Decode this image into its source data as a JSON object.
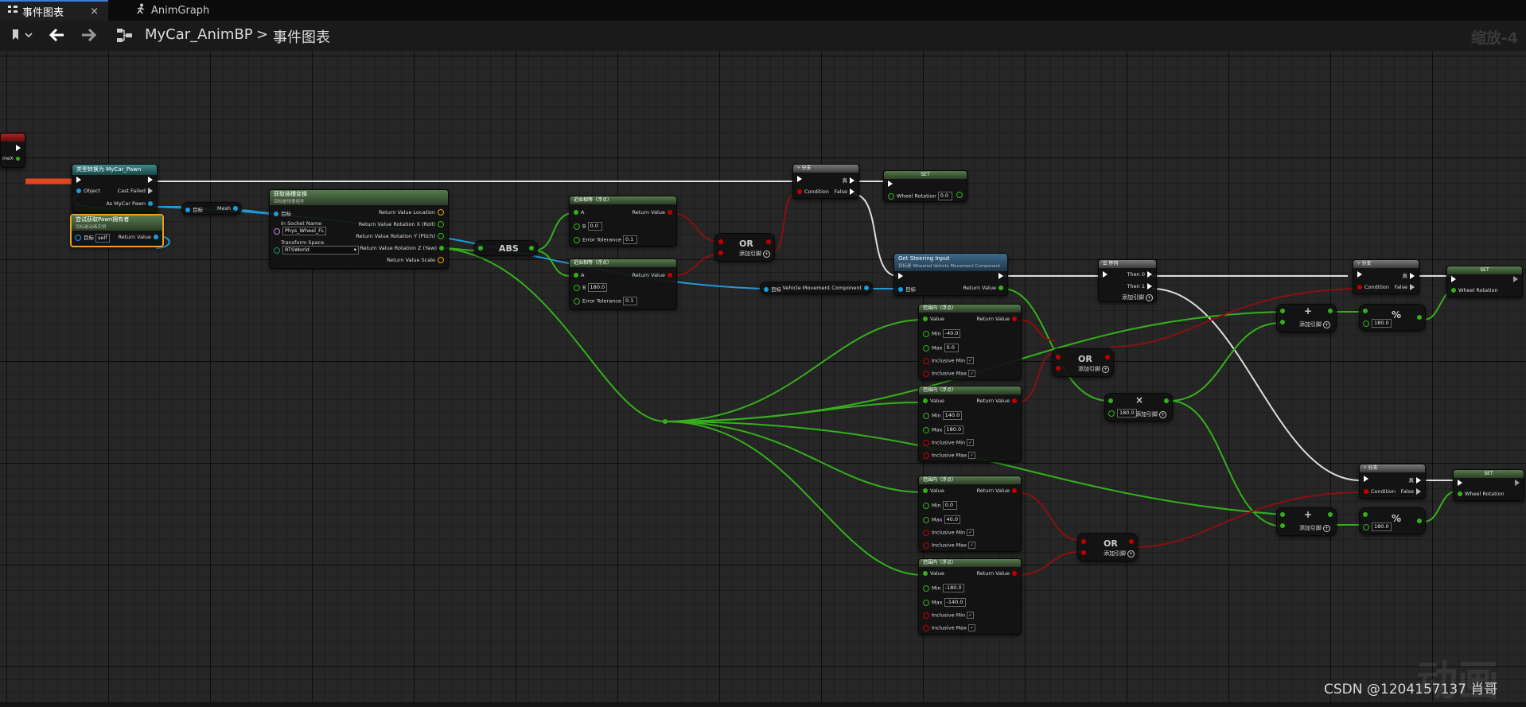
{
  "tabs": [
    {
      "label": "事件图表",
      "close": "×",
      "icon": "event-graph-icon"
    },
    {
      "label": "AnimGraph",
      "icon": "anim-graph-icon"
    }
  ],
  "toolbar": {
    "breadcrumb_root": "MyCar_AnimBP",
    "breadcrumb_sep": ">",
    "breadcrumb_current": "事件图表",
    "zoom": "缩放-4"
  },
  "watermark": {
    "big": "动画",
    "caption": "CSDN @1204157137 肖哥"
  },
  "colors": {
    "exec": "#ffffff",
    "bool": "#c00000",
    "float": "#34b01a",
    "object": "#1f9ad8",
    "struct": "#f0a000",
    "name": "#c27ee3",
    "accent": "#3a7bd5"
  },
  "nodes": {
    "left_edge": {
      "pin_label": "meX"
    },
    "cast": {
      "title": "类型转换为 MyCar_Pawn",
      "exec_in": "",
      "object": "Object",
      "cast_failed": "Cast Failed",
      "as_pawn": "As MyCar Pawn"
    },
    "try_get": {
      "title": "尝试获取Pawn拥有者",
      "subtitle": "目标是动画实例",
      "target": "目标",
      "target_value": "self",
      "return": "Return Value"
    },
    "mesh": {
      "target": "目标",
      "mesh": "Mesh"
    },
    "socket": {
      "title": "获取插槽变换",
      "subtitle": "目标是场景组件",
      "target": "目标",
      "in_socket": "In Socket Name",
      "socket_value": "Phys_Wheel_FL",
      "transform_space": "Transform Space",
      "space_value": "RTSWorld",
      "out": [
        "Return Value Location",
        "Return Value Rotation X (Roll)",
        "Return Value Rotation Y (Pitch)",
        "Return Value Rotation Z (Yaw)",
        "Return Value Scale"
      ]
    },
    "abs": {
      "label": "ABS"
    },
    "near1": {
      "title": "近似相等（浮点）",
      "a": "A",
      "b": "B",
      "b_value": "0.0",
      "tol": "Error Tolerance",
      "tol_value": "0.1",
      "ret": "Return Value"
    },
    "near2": {
      "title": "近似相等（浮点）",
      "a": "A",
      "b": "B",
      "b_value": "180.0",
      "tol": "Error Tolerance",
      "tol_value": "0.1",
      "ret": "Return Value"
    },
    "or1": {
      "label": "OR",
      "add": "添加引脚"
    },
    "branch1": {
      "title": "分支",
      "true": "真",
      "false": "False",
      "condition": "Condition"
    },
    "set1": {
      "title": "SET",
      "pin": "Wheel Rotation",
      "value": "0.0"
    },
    "vehicle": {
      "target": "目标",
      "out": "Vehicle Movement Component"
    },
    "steering": {
      "title": "Get Steering Input",
      "subtitle": "目标是 Wheeled Vehicle Movement Component",
      "target": "目标",
      "ret": "Return Value"
    },
    "sequence": {
      "title": "序列",
      "then0": "Then 0",
      "then1": "Then 1",
      "add": "添加引脚"
    },
    "inrange1": {
      "title": "范围内（浮点）",
      "value": "Value",
      "min": "Min",
      "min_value": "-40.0",
      "max": "Max",
      "max_value": "0.0",
      "incmin": "Inclusive Min",
      "incmax": "Inclusive Max",
      "ret": "Return Value"
    },
    "inrange2": {
      "title": "范围内（浮点）",
      "value": "Value",
      "min": "Min",
      "min_value": "140.0",
      "max": "Max",
      "max_value": "180.0",
      "incmin": "Inclusive Min",
      "incmax": "Inclusive Max",
      "ret": "Return Value"
    },
    "inrange3": {
      "title": "范围内（浮点）",
      "value": "Value",
      "min": "Min",
      "min_value": "0.0",
      "max": "Max",
      "max_value": "40.0",
      "incmin": "Inclusive Min",
      "incmax": "Inclusive Max",
      "ret": "Return Value"
    },
    "inrange4": {
      "title": "范围内（浮点）",
      "value": "Value",
      "min": "Min",
      "min_value": "-180.0",
      "max": "Max",
      "max_value": "-140.0",
      "incmin": "Inclusive Min",
      "incmax": "Inclusive Max",
      "ret": "Return Value"
    },
    "or2": {
      "label": "OR",
      "add": "添加引脚"
    },
    "or3": {
      "label": "OR",
      "add": "添加引脚"
    },
    "multiply": {
      "symbol": "×",
      "value": "180.0",
      "add": "添加引脚"
    },
    "add1": {
      "symbol": "+",
      "add": "添加引脚"
    },
    "add2": {
      "symbol": "+",
      "add": "添加引脚"
    },
    "mod1": {
      "symbol": "%",
      "value": "180.0"
    },
    "mod2": {
      "symbol": "%",
      "value": "180.0"
    },
    "branch2": {
      "title": "分支",
      "true": "真",
      "false": "False",
      "condition": "Condition"
    },
    "branch3": {
      "title": "分支",
      "true": "真",
      "false": "False",
      "condition": "Condition"
    },
    "set2": {
      "title": "SET",
      "pin": "Wheel Rotation"
    },
    "set3": {
      "title": "SET",
      "pin": "Wheel Rotation"
    }
  }
}
